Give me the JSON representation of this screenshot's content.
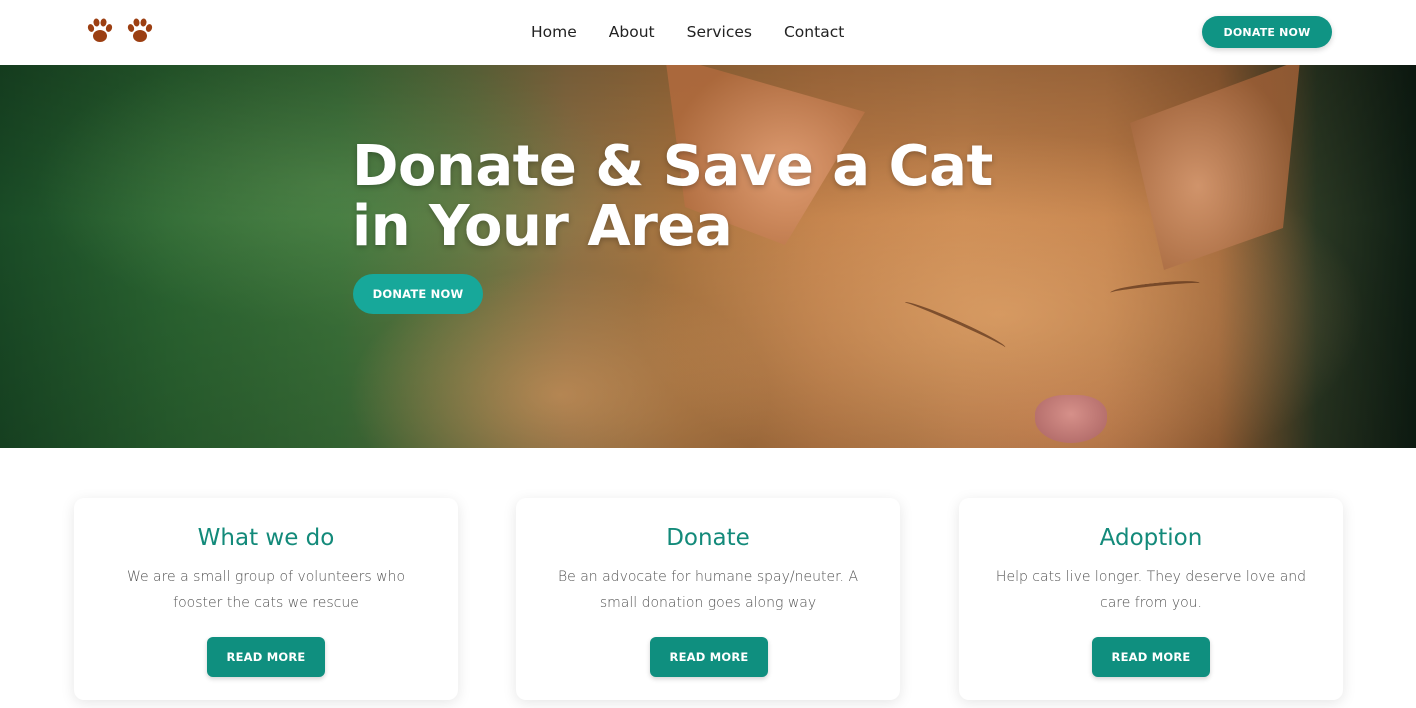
{
  "header": {
    "logo_icons": [
      "paw-icon",
      "paw-icon"
    ],
    "nav": [
      {
        "label": "Home"
      },
      {
        "label": "About"
      },
      {
        "label": "Services"
      },
      {
        "label": "Contact"
      }
    ],
    "donate_label": "DONATE NOW"
  },
  "hero": {
    "title": "Donate & Save a Cat in Your Area",
    "button_label": "DONATE NOW"
  },
  "cards": [
    {
      "title": "What we do",
      "text": "We are a small group of volunteers who fooster the cats we rescue",
      "button_label": "READ MORE"
    },
    {
      "title": "Donate",
      "text": "Be an advocate for humane spay/neuter. A small donation goes along way",
      "button_label": "READ MORE"
    },
    {
      "title": "Adoption",
      "text": "Help cats live longer. They deserve love and care from you.",
      "button_label": "READ MORE"
    }
  ],
  "colors": {
    "accent": "#0f9484",
    "accent_light": "#17a89a",
    "card_title": "#138a7a",
    "logo": "#9c3f12"
  }
}
